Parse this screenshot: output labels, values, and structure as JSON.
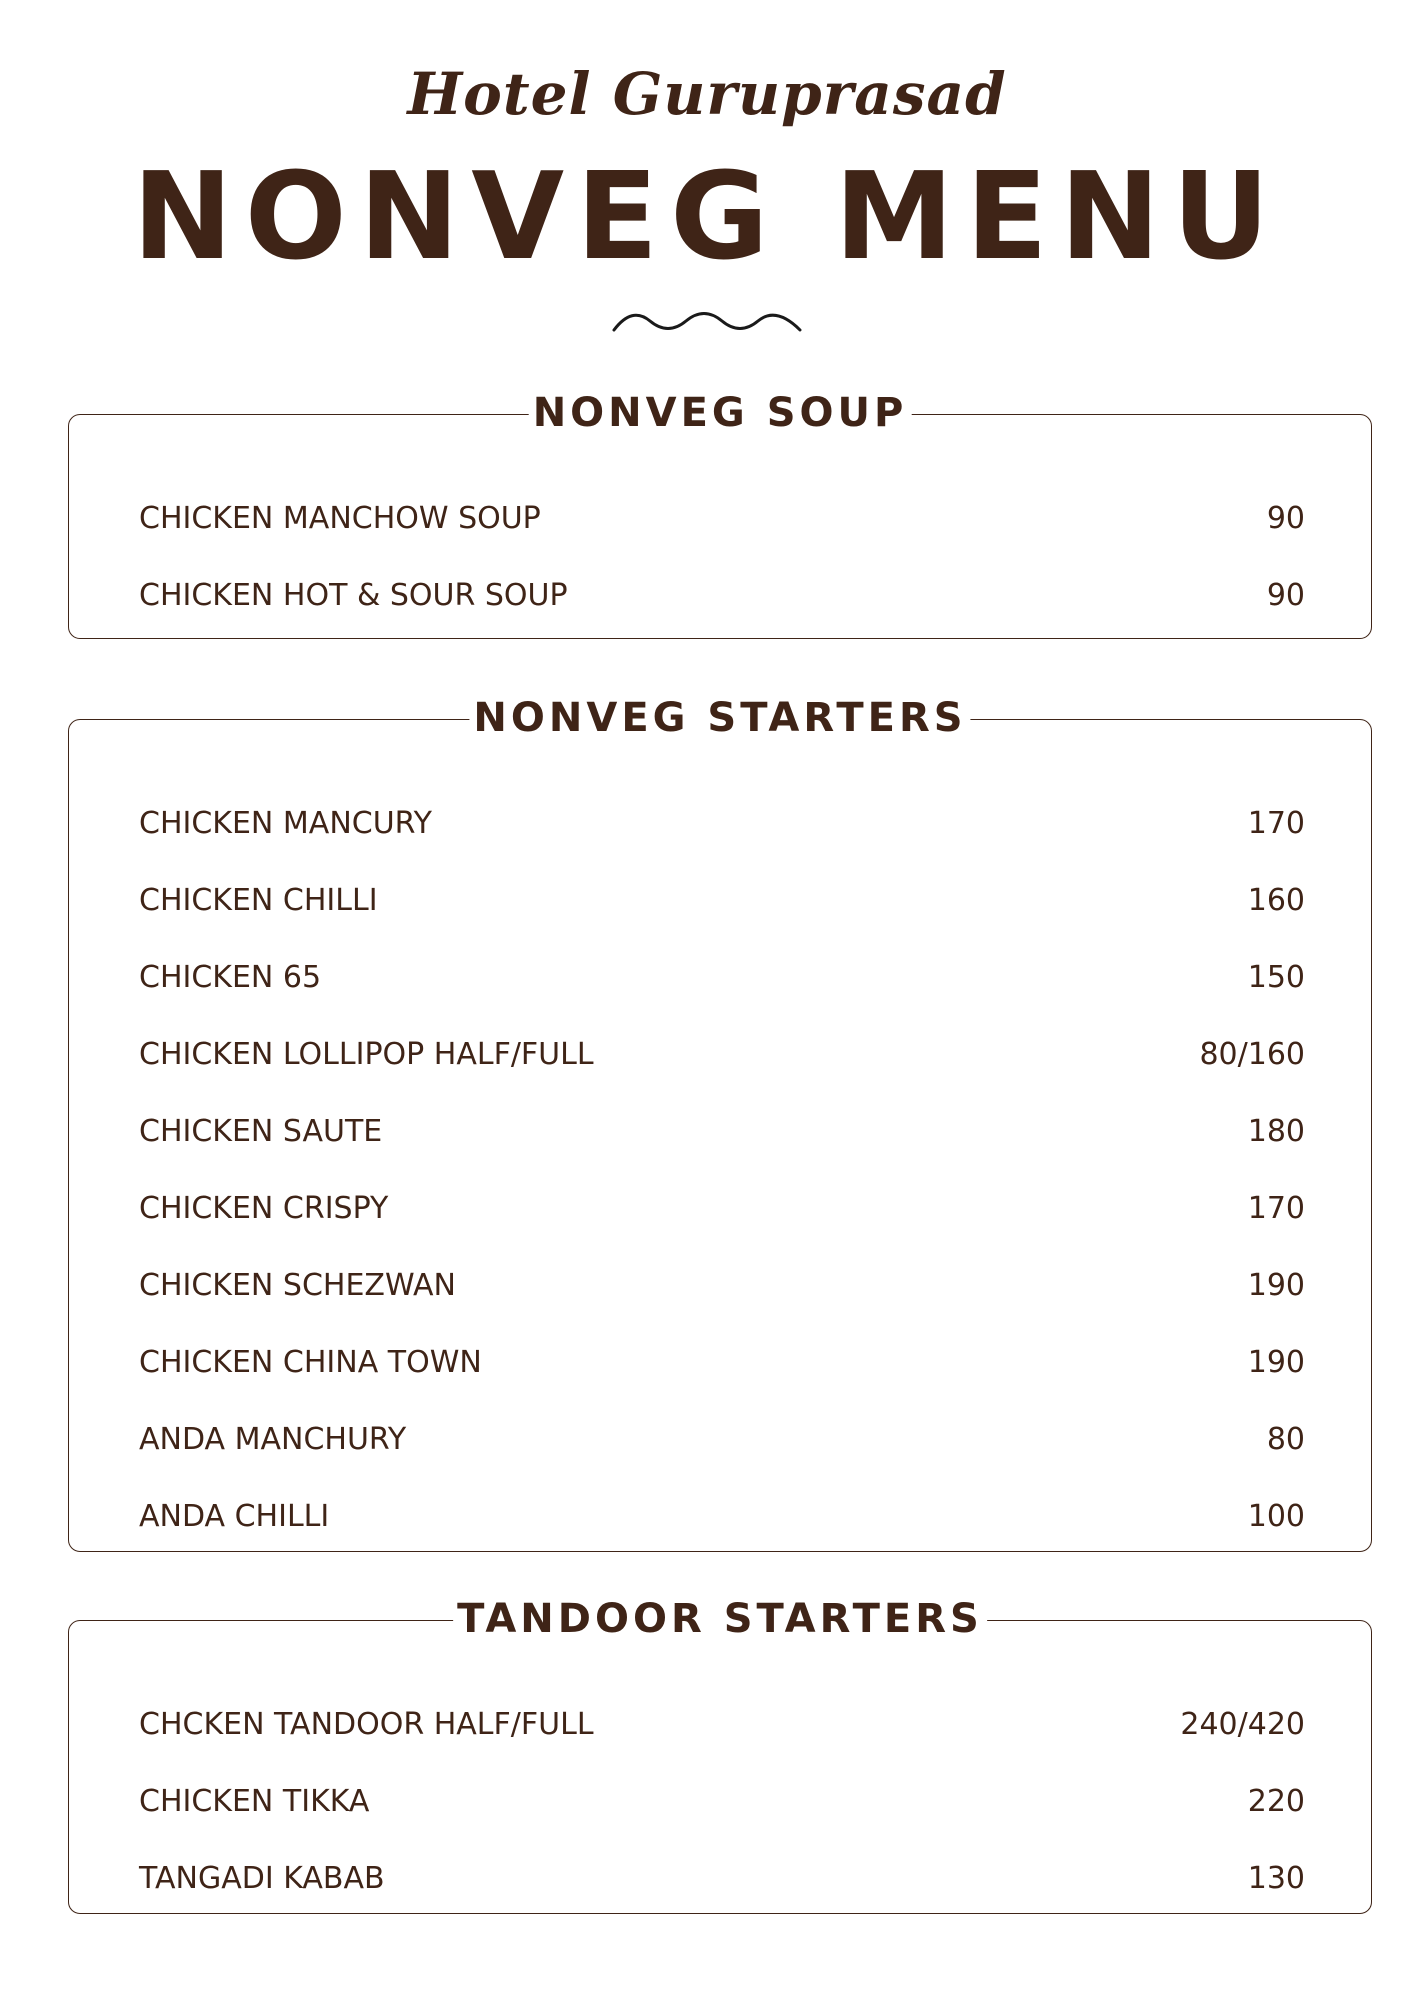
{
  "hotel_name": "Hotel Guruprasad",
  "title": "NONVEG MENU",
  "sections": [
    {
      "title": "NONVEG SOUP",
      "items": [
        {
          "name": "CHICKEN MANCHOW SOUP",
          "price": "90"
        },
        {
          "name": "CHICKEN HOT & SOUR SOUP",
          "price": "90"
        }
      ]
    },
    {
      "title": "NONVEG STARTERS",
      "items": [
        {
          "name": "CHICKEN MANCURY",
          "price": "170"
        },
        {
          "name": "CHICKEN CHILLI",
          "price": "160"
        },
        {
          "name": "CHICKEN 65",
          "price": "150"
        },
        {
          "name": "CHICKEN LOLLIPOP HALF/FULL",
          "price": "80/160"
        },
        {
          "name": "CHICKEN SAUTE",
          "price": "180"
        },
        {
          "name": "CHICKEN CRISPY",
          "price": "170"
        },
        {
          "name": "CHICKEN SCHEZWAN",
          "price": "190"
        },
        {
          "name": "CHICKEN CHINA TOWN",
          "price": "190"
        },
        {
          "name": "ANDA MANCHURY",
          "price": "80"
        },
        {
          "name": "ANDA CHILLI",
          "price": "100"
        }
      ]
    },
    {
      "title": "TANDOOR STARTERS",
      "items": [
        {
          "name": "CHCKEN TANDOOR HALF/FULL",
          "price": "240/420"
        },
        {
          "name": "CHICKEN TIKKA",
          "price": "220"
        },
        {
          "name": "TANGADI KABAB",
          "price": "130"
        }
      ]
    }
  ],
  "colors": {
    "text": "#3f2417",
    "background": "#ffffff"
  }
}
